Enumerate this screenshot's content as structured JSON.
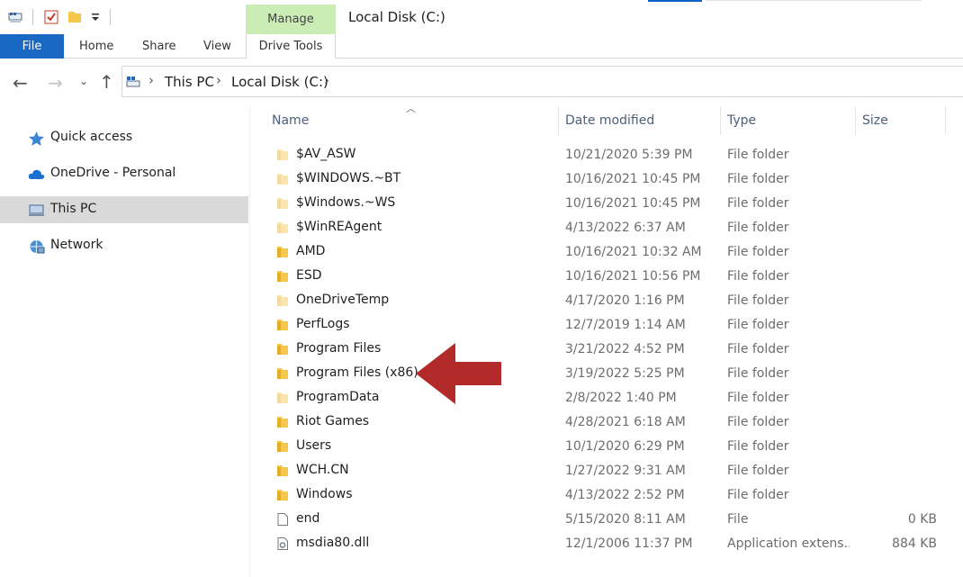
{
  "window": {
    "title": "Local Disk (C:)"
  },
  "ribbon": {
    "file_tab": "File",
    "tabs": [
      "Home",
      "Share",
      "View"
    ],
    "context_group": "Manage",
    "context_tab": "Drive Tools"
  },
  "address": {
    "crumbs": [
      "This PC",
      "Local Disk (C:)"
    ]
  },
  "nav": {
    "items": [
      {
        "label": "Quick access",
        "icon": "star-icon",
        "selected": false
      },
      {
        "label": "OneDrive - Personal",
        "icon": "cloud-icon",
        "selected": false
      },
      {
        "label": "This PC",
        "icon": "computer-icon",
        "selected": true
      },
      {
        "label": "Network",
        "icon": "network-icon",
        "selected": false
      }
    ]
  },
  "columns": {
    "name": "Name",
    "date": "Date modified",
    "type": "Type",
    "size": "Size"
  },
  "files": [
    {
      "name": "$AV_ASW",
      "date": "10/21/2020 5:39 PM",
      "type": "File folder",
      "size": "",
      "icon": "folder-icon",
      "faded": true
    },
    {
      "name": "$WINDOWS.~BT",
      "date": "10/16/2021 10:45 PM",
      "type": "File folder",
      "size": "",
      "icon": "folder-icon",
      "faded": true
    },
    {
      "name": "$Windows.~WS",
      "date": "10/16/2021 10:45 PM",
      "type": "File folder",
      "size": "",
      "icon": "folder-icon",
      "faded": true
    },
    {
      "name": "$WinREAgent",
      "date": "4/13/2022 6:37 AM",
      "type": "File folder",
      "size": "",
      "icon": "folder-icon",
      "faded": true
    },
    {
      "name": "AMD",
      "date": "10/16/2021 10:32 AM",
      "type": "File folder",
      "size": "",
      "icon": "folder-icon",
      "faded": false
    },
    {
      "name": "ESD",
      "date": "10/16/2021 10:56 PM",
      "type": "File folder",
      "size": "",
      "icon": "folder-icon",
      "faded": false
    },
    {
      "name": "OneDriveTemp",
      "date": "4/17/2020 1:16 PM",
      "type": "File folder",
      "size": "",
      "icon": "folder-icon",
      "faded": true
    },
    {
      "name": "PerfLogs",
      "date": "12/7/2019 1:14 AM",
      "type": "File folder",
      "size": "",
      "icon": "folder-icon",
      "faded": false
    },
    {
      "name": "Program Files",
      "date": "3/21/2022 4:52 PM",
      "type": "File folder",
      "size": "",
      "icon": "folder-icon",
      "faded": false
    },
    {
      "name": "Program Files (x86)",
      "date": "3/19/2022 5:25 PM",
      "type": "File folder",
      "size": "",
      "icon": "folder-icon",
      "faded": false
    },
    {
      "name": "ProgramData",
      "date": "2/8/2022 1:40 PM",
      "type": "File folder",
      "size": "",
      "icon": "folder-icon",
      "faded": true
    },
    {
      "name": "Riot Games",
      "date": "4/28/2021 6:18 AM",
      "type": "File folder",
      "size": "",
      "icon": "folder-icon",
      "faded": false
    },
    {
      "name": "Users",
      "date": "10/1/2020 6:29 PM",
      "type": "File folder",
      "size": "",
      "icon": "folder-icon",
      "faded": false
    },
    {
      "name": "WCH.CN",
      "date": "1/27/2022 9:31 AM",
      "type": "File folder",
      "size": "",
      "icon": "folder-icon",
      "faded": false
    },
    {
      "name": "Windows",
      "date": "4/13/2022 2:52 PM",
      "type": "File folder",
      "size": "",
      "icon": "folder-icon",
      "faded": false
    },
    {
      "name": "end",
      "date": "5/15/2020 8:11 AM",
      "type": "File",
      "size": "0 KB",
      "icon": "file-icon",
      "faded": false
    },
    {
      "name": "msdia80.dll",
      "date": "12/1/2006 11:37 PM",
      "type": "Application extens...",
      "size": "884 KB",
      "icon": "dll-icon",
      "faded": false
    }
  ],
  "annotation": {
    "icon": "red-arrow-icon",
    "color": "#b22a2a"
  },
  "colors": {
    "accent": "#1969c3",
    "manage_group": "#c9edb5",
    "selected": "#d9d9d9",
    "folder": "#f5c84c"
  }
}
